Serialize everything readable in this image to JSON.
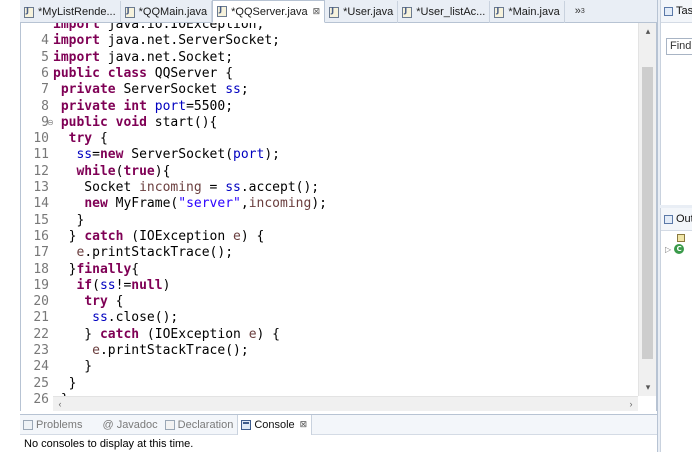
{
  "editor_tabs": [
    {
      "label": "*MyListRende...",
      "active": false
    },
    {
      "label": "*QQMain.java",
      "active": false
    },
    {
      "label": "*QQServer.java",
      "active": true,
      "close": "⊠"
    },
    {
      "label": "*User.java",
      "active": false
    },
    {
      "label": "*User_listAc...",
      "active": false
    },
    {
      "label": "*Main.java",
      "active": false
    }
  ],
  "overflow_tabs": {
    "symbol": "»",
    "count": "3"
  },
  "code_lines": [
    {
      "n": "",
      "html": "<span class=\"kw\">import</span> java.io.IOException;"
    },
    {
      "n": "4",
      "html": "<span class=\"kw\">import</span> java.net.ServerSocket;"
    },
    {
      "n": "5",
      "html": "<span class=\"kw\">import</span> java.net.Socket;"
    },
    {
      "n": "6",
      "html": "<span class=\"kw\">public class</span> QQServer {"
    },
    {
      "n": "7",
      "html": " <span class=\"kw\">private</span> ServerSocket <span class=\"fld\">ss</span>;"
    },
    {
      "n": "8",
      "html": " <span class=\"kw\">private int</span> <span class=\"fld\">port</span>=5500;"
    },
    {
      "n": "9",
      "html": " <span class=\"kw\">public void</span> start(){",
      "fold": true
    },
    {
      "n": "10",
      "html": "  <span class=\"kw\">try</span> {"
    },
    {
      "n": "11",
      "html": "   <span class=\"fld\">ss</span>=<span class=\"kw\">new</span> ServerSocket(<span class=\"fld\">port</span>);"
    },
    {
      "n": "12",
      "html": "   <span class=\"kw\">while</span>(<span class=\"kw\">true</span>){"
    },
    {
      "n": "13",
      "html": "    Socket <span class=\"var\">incoming</span> = <span class=\"fld\">ss</span>.accept();"
    },
    {
      "n": "14",
      "html": "    <span class=\"kw\">new</span> MyFrame(<span class=\"str\">\"server\"</span>,<span class=\"var\">incoming</span>);"
    },
    {
      "n": "15",
      "html": "   }"
    },
    {
      "n": "16",
      "html": "  } <span class=\"kw\">catch</span> (IOException <span class=\"var\">e</span>) {"
    },
    {
      "n": "17",
      "html": "   <span class=\"var\">e</span>.printStackTrace();"
    },
    {
      "n": "18",
      "html": "  }<span class=\"kw\">finally</span>{"
    },
    {
      "n": "19",
      "html": "   <span class=\"kw\">if</span>(<span class=\"fld\">ss</span>!=<span class=\"kw\">null</span>)"
    },
    {
      "n": "20",
      "html": "    <span class=\"kw\">try</span> {"
    },
    {
      "n": "21",
      "html": "     <span class=\"fld\">ss</span>.close();"
    },
    {
      "n": "22",
      "html": "    } <span class=\"kw\">catch</span> (IOException <span class=\"var\">e</span>) {"
    },
    {
      "n": "23",
      "html": "     <span class=\"var\">e</span>.printStackTrace();"
    },
    {
      "n": "24",
      "html": "    }"
    },
    {
      "n": "25",
      "html": "  }"
    },
    {
      "n": "26",
      "html": " }"
    }
  ],
  "console_tabs": [
    {
      "label": "Problems",
      "icon": "problems",
      "active": false
    },
    {
      "label": "@ Javadoc",
      "icon": "javadoc",
      "active": false
    },
    {
      "label": "Declaration",
      "icon": "decl",
      "active": false
    },
    {
      "label": "Console",
      "icon": "cons",
      "active": true,
      "close": "⊠"
    }
  ],
  "console_message": "No consoles to display at this time.",
  "task_list": {
    "title": "Task",
    "find_placeholder": "Find"
  },
  "outline": {
    "title": "Out"
  },
  "scroll": {
    "up": "▴",
    "down": "▾",
    "left": "‹",
    "right": "›"
  }
}
